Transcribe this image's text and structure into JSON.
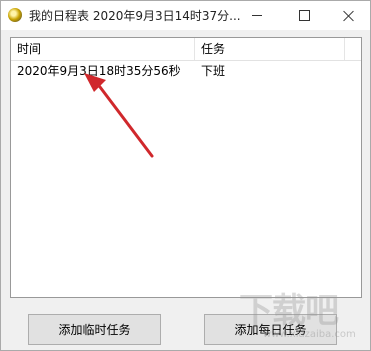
{
  "window": {
    "title": "我的日程表 2020年9月3日14时37分..."
  },
  "list": {
    "columns": [
      "时间",
      "任务"
    ],
    "rows": [
      {
        "time": "2020年9月3日18时35分56秒",
        "task": "下班"
      }
    ]
  },
  "buttons": {
    "add_temp": "添加临时任务",
    "add_daily": "添加每日任务"
  },
  "annotation": {
    "arrow_color": "#d0282c"
  },
  "watermark": {
    "big": "下载吧",
    "small": "www.xiazaiba.com"
  }
}
